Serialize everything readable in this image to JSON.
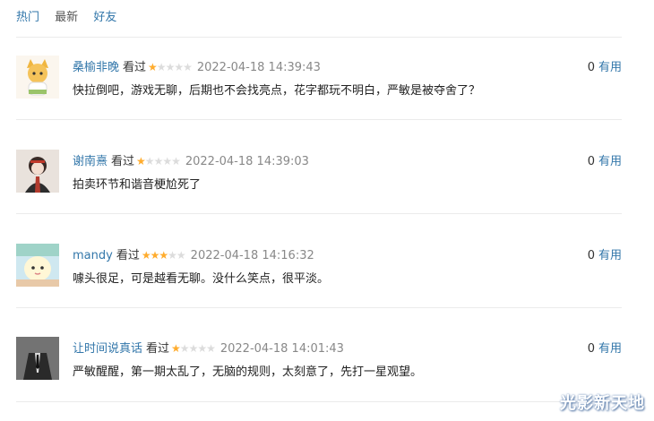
{
  "tabs": [
    {
      "label": "热门",
      "active": true
    },
    {
      "label": "最新",
      "active": false
    },
    {
      "label": "好友",
      "active": false
    }
  ],
  "comments": [
    {
      "user": "桑榆非晚",
      "status": "看过",
      "rating": 1,
      "time": "2022-04-18 14:39:43",
      "text": "快拉倒吧，游戏无聊，后期也不会找亮点，花字都玩不明白，严敏是被夺舍了？",
      "votes": "0",
      "vote_label": "有用"
    },
    {
      "user": "谢南熹",
      "status": "看过",
      "rating": 1,
      "time": "2022-04-18 14:39:03",
      "text": "拍卖环节和谐音梗尬死了",
      "votes": "0",
      "vote_label": "有用"
    },
    {
      "user": "mandy",
      "status": "看过",
      "rating": 3,
      "time": "2022-04-18 14:16:32",
      "text": "噱头很足，可是越看无聊。没什么笑点，很平淡。",
      "votes": "0",
      "vote_label": "有用"
    },
    {
      "user": "让时间说真话",
      "status": "看过",
      "rating": 1,
      "time": "2022-04-18 14:01:43",
      "text": "严敏醒醒，第一期太乱了，无脑的规则，太刻意了，先打一星观望。",
      "votes": "0",
      "vote_label": "有用"
    }
  ],
  "colors": {
    "link": "#3377aa",
    "star_on": "#ffac2d",
    "star_off": "#dcdcdc",
    "time": "#888888"
  },
  "watermark": "光影新天地"
}
